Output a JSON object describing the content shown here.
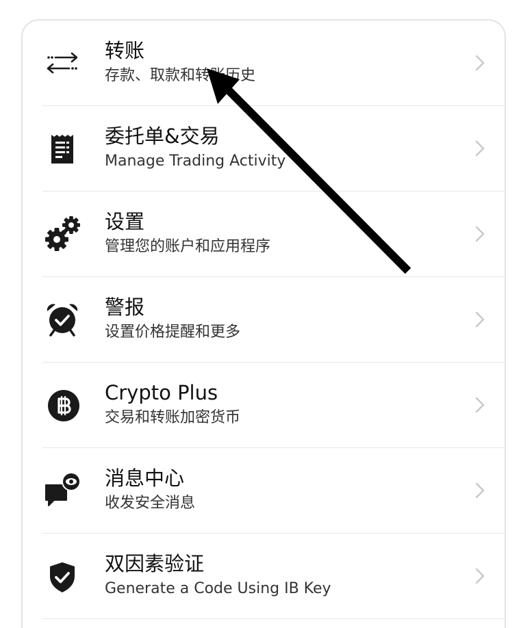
{
  "menu": {
    "items": [
      {
        "title": "转账",
        "subtitle": "存款、取款和转账历史",
        "icon": "transfer-arrows-icon"
      },
      {
        "title": "委托单&交易",
        "subtitle": "Manage Trading Activity",
        "icon": "receipt-icon"
      },
      {
        "title": "设置",
        "subtitle": "管理您的账户和应用程序",
        "icon": "gears-icon"
      },
      {
        "title": "警报",
        "subtitle": "设置价格提醒和更多",
        "icon": "alarm-clock-icon"
      },
      {
        "title": "Crypto Plus",
        "subtitle": "交易和转账加密货币",
        "icon": "bitcoin-icon"
      },
      {
        "title": "消息中心",
        "subtitle": "收发安全消息",
        "icon": "message-eye-icon"
      },
      {
        "title": "双因素验证",
        "subtitle": "Generate a Code Using IB Key",
        "icon": "shield-check-icon"
      }
    ]
  },
  "colors": {
    "icon": "#1a1a1a",
    "title": "#111111",
    "subtitle": "#333333",
    "chevron": "#c8c8c8",
    "divider": "#e6e6e6",
    "annotation_arrow": "#000000"
  }
}
